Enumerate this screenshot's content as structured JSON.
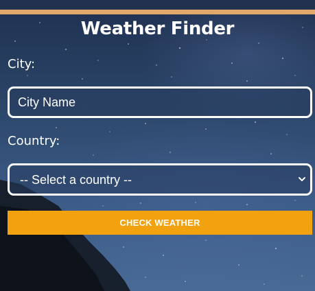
{
  "app": {
    "title": "Weather Finder"
  },
  "form": {
    "city_label": "City:",
    "city_placeholder": "City Name",
    "city_value": "",
    "country_label": "Country:",
    "country_selected": "-- Select a country --",
    "submit_label": "CHECK WEATHER"
  },
  "colors": {
    "accent_bar": "#e0a86a",
    "button": "#f2a20f",
    "text": "#ffffff",
    "background": "#2b4568"
  },
  "icons": {
    "select_caret": "chevron-down-icon"
  }
}
